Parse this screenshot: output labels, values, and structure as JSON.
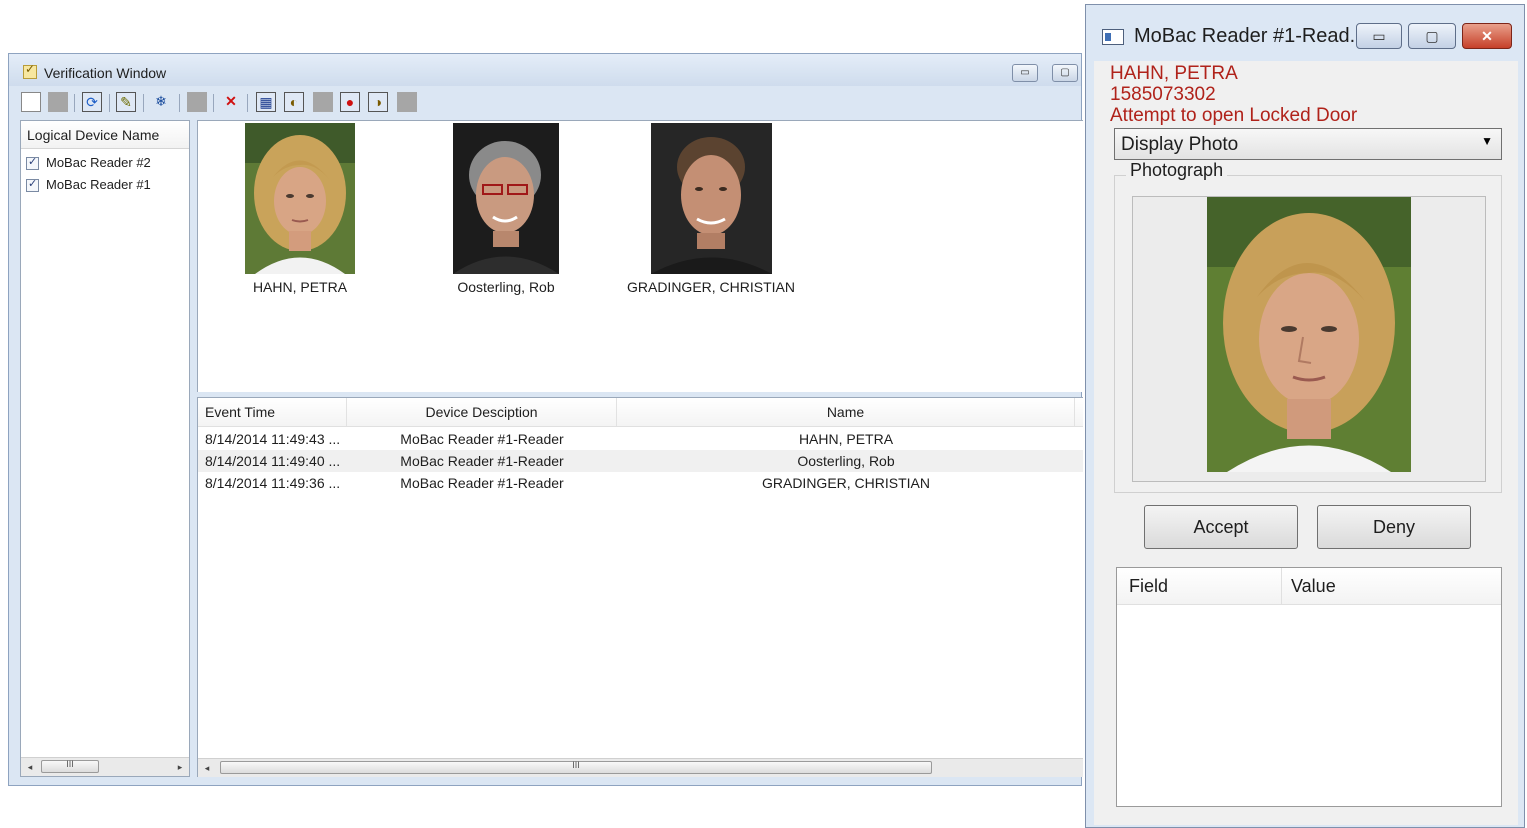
{
  "verification_window": {
    "title": "Verification Window",
    "minimize_glyph": "▭",
    "maximize_glyph": "▢",
    "toolbar_glyphs": {
      "refresh": "⟳",
      "edit": "✎",
      "snowflake": "❄",
      "delete": "✕",
      "scan": "▦",
      "audio": "◐",
      "stop": "●",
      "sound": "◑"
    },
    "device_panel": {
      "header": "Logical Device Name",
      "devices": [
        {
          "label": "MoBac Reader #2",
          "checked": "✓"
        },
        {
          "label": "MoBac Reader #1",
          "checked": "✓"
        }
      ],
      "scroll_left": "◂",
      "scroll_right": "▸",
      "scroll_thumb": "III"
    },
    "photos": [
      {
        "name": "HAHN, PETRA"
      },
      {
        "name": "Oosterling, Rob"
      },
      {
        "name": "GRADINGER, CHRISTIAN"
      }
    ],
    "event_list": {
      "columns": [
        "Event Time",
        "Device Desciption",
        "Name"
      ],
      "rows": [
        {
          "time": "8/14/2014 11:49:43 ...",
          "device": "MoBac Reader #1-Reader",
          "name": "HAHN, PETRA"
        },
        {
          "time": "8/14/2014 11:49:40 ...",
          "device": "MoBac Reader #1-Reader",
          "name": "Oosterling, Rob"
        },
        {
          "time": "8/14/2014 11:49:36 ...",
          "device": "MoBac Reader #1-Reader",
          "name": "GRADINGER, CHRISTIAN"
        }
      ],
      "scroll_left": "◂",
      "scroll_thumb": "III"
    }
  },
  "reader_window": {
    "title": "MoBac Reader #1-Read...",
    "minimize_glyph": "▭",
    "maximize_glyph": "▢",
    "close_glyph": "✕",
    "person_name": "HAHN, PETRA",
    "card_number": "1585073302",
    "event_message": "Attempt to open Locked Door",
    "display_select": {
      "value": "Display Photo",
      "arrow": "▼"
    },
    "photo_group_label": "Photograph",
    "accept_label": "Accept",
    "deny_label": "Deny",
    "grid_columns": [
      "Field",
      "Value"
    ]
  },
  "colors": {
    "alert_red": "#b0221a",
    "window_frame": "#dbe6f3"
  }
}
